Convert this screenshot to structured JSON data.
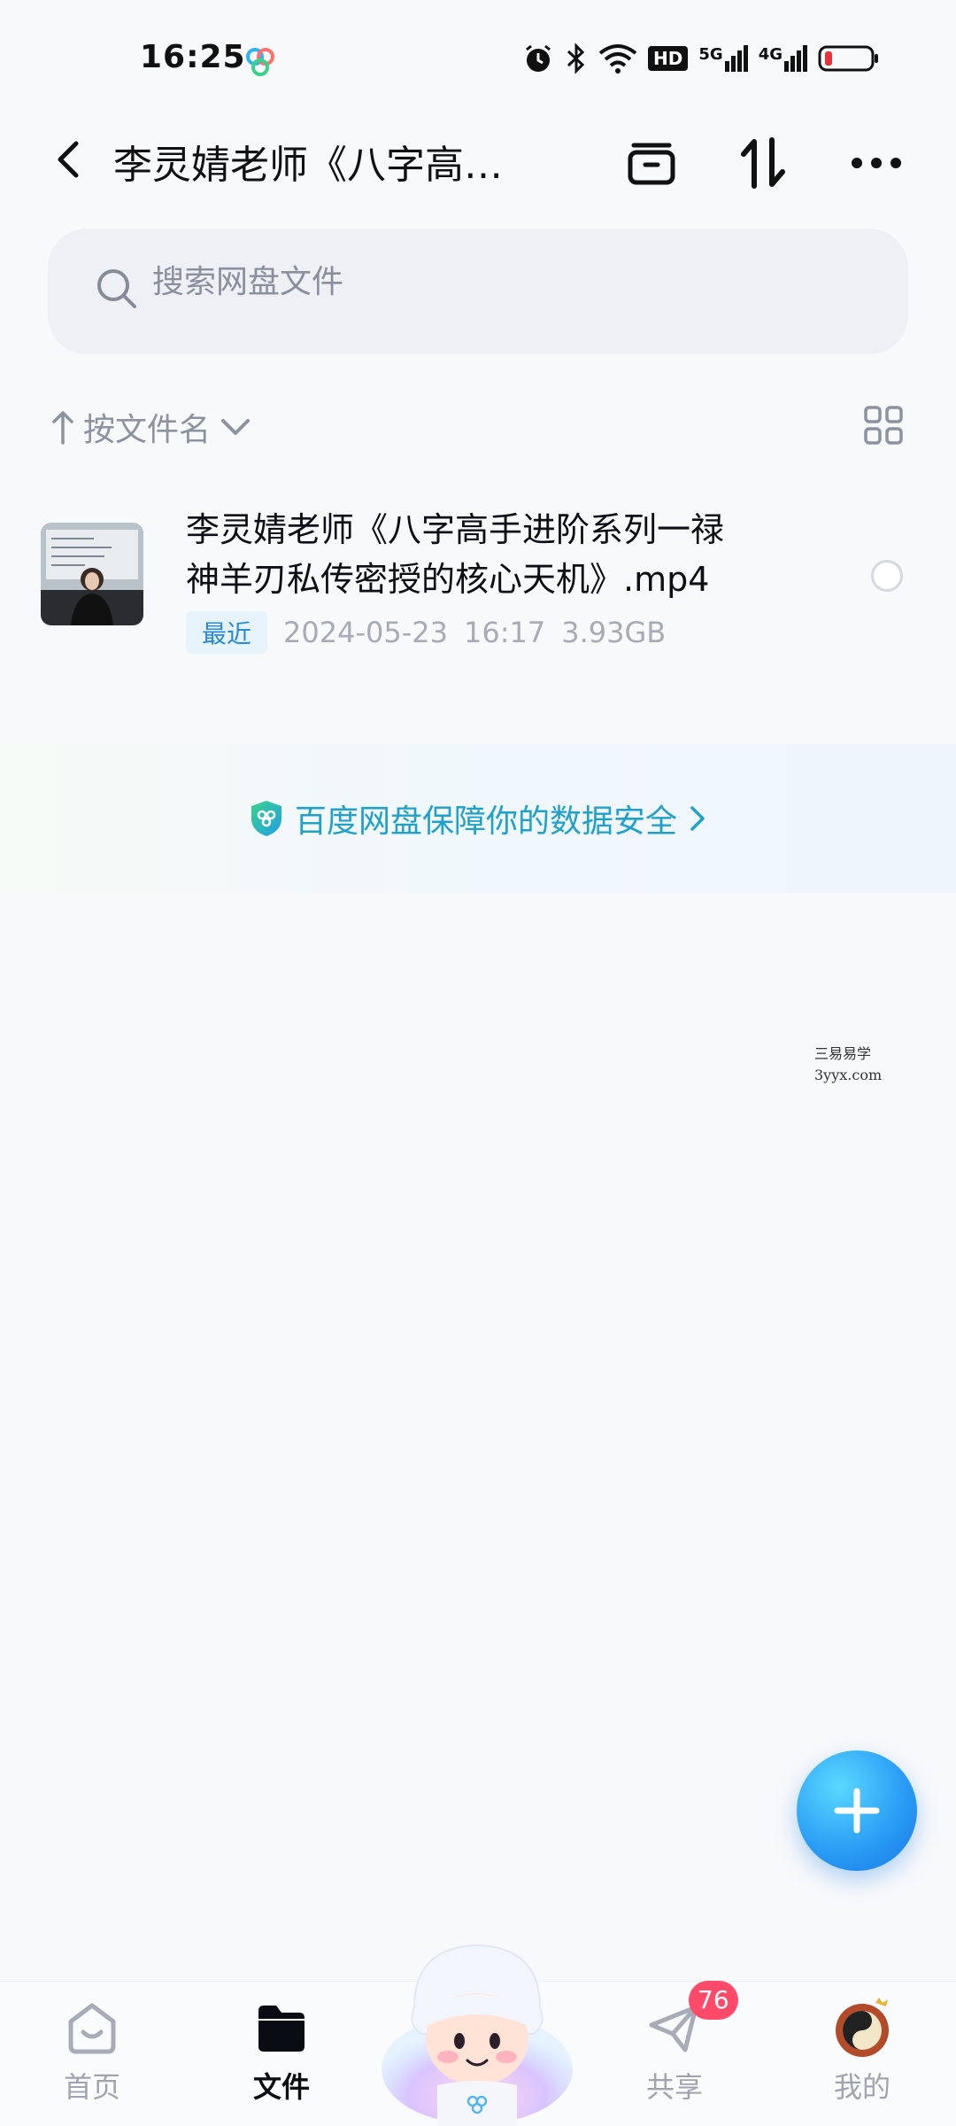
{
  "status_bar": {
    "time": "16:25",
    "network_5g": "5G",
    "network_4g": "4G",
    "hd_label": "HD"
  },
  "header": {
    "title": "李灵婧老师《八字高…",
    "icons": [
      "back-icon",
      "archive-icon",
      "sort-swap-icon",
      "more-icon"
    ]
  },
  "search": {
    "placeholder": "搜索网盘文件"
  },
  "sort": {
    "label": "按文件名"
  },
  "files": [
    {
      "name_line1": "李灵婧老师《八字高手进阶系列一禄",
      "name_line2": "神羊刃私传密授的核心天机》.mp4",
      "badge": "最近",
      "date": "2024-05-23",
      "time": "16:17",
      "size": "3.93GB"
    }
  ],
  "security_banner": {
    "text": "百度网盘保障你的数据安全"
  },
  "watermark": {
    "line1": "三易易学",
    "line2": "3yyx.com"
  },
  "bottom_nav": {
    "items": [
      {
        "label": "首页",
        "icon": "home-icon"
      },
      {
        "label": "文件",
        "icon": "folder-icon"
      },
      {
        "label": "",
        "icon": "mascot-icon"
      },
      {
        "label": "共享",
        "icon": "share-icon"
      },
      {
        "label": "我的",
        "icon": "profile-avatar"
      }
    ],
    "share_badge": "76"
  },
  "colors": {
    "accent": "#21a0c8",
    "fab": "#2b9ef5",
    "badge": "#ff4a6a"
  }
}
